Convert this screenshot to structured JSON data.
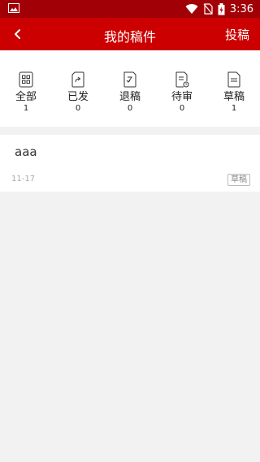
{
  "status_bar": {
    "time": "3:36",
    "icons": [
      "image-icon",
      "wifi-icon",
      "no-sim-icon",
      "battery-charging-icon"
    ]
  },
  "app_bar": {
    "back_icon": "chevron-left-icon",
    "title": "我的稿件",
    "submit_label": "投稿"
  },
  "stats": [
    {
      "label": "全部",
      "count": "1",
      "icon": "grid-icon"
    },
    {
      "label": "已发",
      "count": "0",
      "icon": "doc-share-icon"
    },
    {
      "label": "退稿",
      "count": "0",
      "icon": "doc-return-icon"
    },
    {
      "label": "待审",
      "count": "0",
      "icon": "doc-pending-icon"
    },
    {
      "label": "草稿",
      "count": "1",
      "icon": "doc-draft-icon"
    }
  ],
  "articles": [
    {
      "title": "aaa",
      "date": "11-17",
      "status": "草稿"
    }
  ],
  "colors": {
    "status_bar": "#a10006",
    "app_bar": "#cc0000",
    "background": "#f2f2f2"
  }
}
